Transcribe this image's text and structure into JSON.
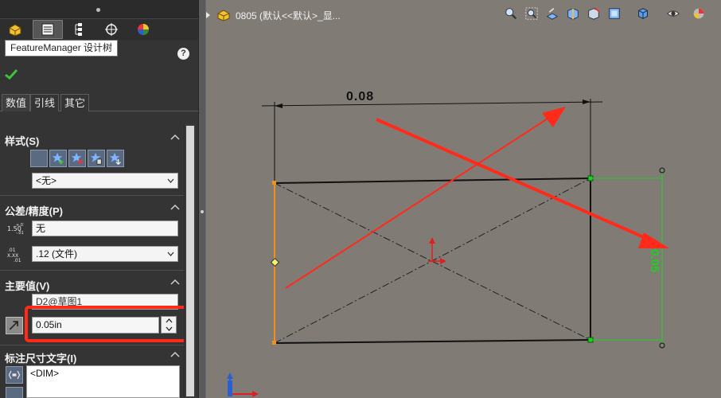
{
  "property_panel": {
    "tooltip": "FeatureManager 设计树",
    "help_label": "?",
    "tabs": [
      "数值",
      "引线",
      "其它"
    ],
    "style": {
      "title": "样式(S)",
      "dropdown_value": "<无>"
    },
    "tolerance": {
      "title": "公差/精度(P)",
      "tolerance_value": "无",
      "precision_value": ".12 (文件)"
    },
    "primary_value": {
      "title": "主要值(V)",
      "dimension_name": "D2@草图1",
      "value": "0.05in"
    },
    "dimension_text": {
      "title": "标注尺寸文字(I)",
      "text": "<DIM>"
    }
  },
  "graphics": {
    "breadcrumb": "0805 (默认<<默认>_显...",
    "dimension_top": "0.08",
    "dimension_right": "0.05"
  },
  "colors": {
    "panel_bg": "#343434",
    "viewport_bg": "#807c75",
    "highlight_red": "#ff2a1a",
    "selected_orange": "#f0901e",
    "dimension_green": "#1fcf1f"
  }
}
